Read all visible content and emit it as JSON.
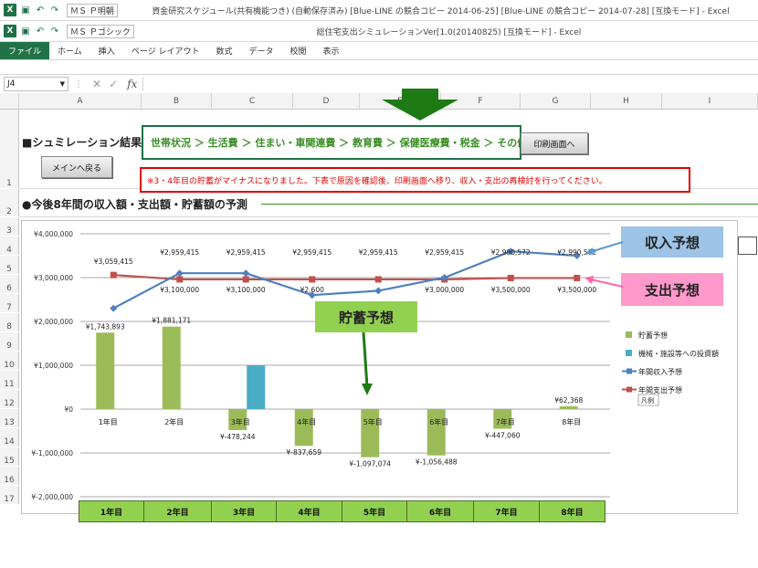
{
  "window1": {
    "title": "資金研究スケジュール(共有機能つき) (自動保存済み) [Blue-LINE の競合コピー 2014-06-25] [Blue-LINE の競合コピー 2014-07-28] [互換モード] - Excel",
    "font": "ＭＳ Ｐ明朝"
  },
  "window2": {
    "title": "総住宅支出シミュレーションVer[1.0(20140825)  [互換モード] - Excel",
    "font": "ＭＳ Ｐゴシック"
  },
  "ribbon": {
    "tabs": [
      "ファイル",
      "ホーム",
      "挿入",
      "ページ レイアウト",
      "数式",
      "データ",
      "校閲",
      "表示"
    ]
  },
  "formula_bar": {
    "name_box": "J4",
    "fx": "fx"
  },
  "columns": [
    "A",
    "B",
    "C",
    "D",
    "E",
    "F",
    "G",
    "H",
    "I"
  ],
  "rows": [
    "1",
    "2",
    "3",
    "4",
    "5",
    "6",
    "7",
    "8",
    "9",
    "10",
    "11",
    "12",
    "13",
    "14",
    "15",
    "16",
    "17"
  ],
  "sheet": {
    "heading": "■シュミレーション結果",
    "back_button": "メインへ戻る",
    "nav_breadcrumb": "世帯状況 ＞ 生活費 ＞ 住まい・車関連費 ＞ 教育費 ＞ 保健医療費・税金 ＞ その他",
    "print_button": "印刷画面へ",
    "warning": "※3・4年目の貯蓄がマイナスになりました。下表で原因を確認後、印刷画面へ移り、収入・支出の再検討を行ってください。",
    "section_title": "●今後8年間の収入額・支出額・貯蓄額の予測"
  },
  "callouts": {
    "income": "収入予想",
    "expense": "支出予想",
    "savings": "貯蓄予想"
  },
  "colors": {
    "savings": "#9bbb59",
    "investment": "#4bacc6",
    "income": "#4f81bd",
    "expense": "#c0504d",
    "callout_blue": "#9dc3e6",
    "callout_pink": "#ff99cc",
    "callout_green": "#92d050",
    "arrow": "#1e7a14"
  },
  "chart_data": {
    "type": "bar",
    "categories": [
      "1年目",
      "2年目",
      "3年目",
      "4年目",
      "5年目",
      "6年目",
      "7年目",
      "8年目"
    ],
    "ylim": [
      -2000000,
      4000000
    ],
    "y_ticks": [
      "¥4,000,000",
      "¥3,000,000",
      "¥2,000,000",
      "¥1,000,000",
      "¥0",
      "¥-1,000,000",
      "¥-2,000,000"
    ],
    "series": [
      {
        "name": "貯蓄予想",
        "type": "bar",
        "values": [
          1743893,
          1881171,
          -478244,
          -837659,
          -1097074,
          -1056488,
          -447060,
          62368
        ],
        "labels": [
          "¥1,743,893",
          "¥1,881,171",
          "¥-478,244",
          "¥-837,659",
          "¥-1,097,074",
          "¥-1,056,488",
          "¥-447,060",
          "¥62,368"
        ]
      },
      {
        "name": "機械・施設等への投資額",
        "type": "bar",
        "values": [
          0,
          0,
          1000000,
          0,
          0,
          0,
          0,
          0
        ]
      },
      {
        "name": "年間収入予想",
        "type": "line",
        "values": [
          2300000,
          3100000,
          3100000,
          2600000,
          2700000,
          3000000,
          3600000,
          3500000
        ],
        "labels": [
          "",
          "¥2,959,415",
          "¥2,959,415",
          "¥2,959,415",
          "¥2,959,415",
          "¥2,959,415",
          "¥2,990,572",
          "¥2,990,572"
        ]
      },
      {
        "name": "年間支出予想",
        "type": "line",
        "values": [
          3059415,
          2959415,
          2959415,
          2959415,
          2959415,
          2959415,
          2990572,
          2990572
        ],
        "labels": [
          "¥3,059,415",
          "¥3,100,000",
          "¥3,100,000",
          "¥2,600",
          "",
          "¥3,000,000",
          "¥3,500,000",
          "¥3,500,000"
        ]
      }
    ],
    "legend_position": "right",
    "legend_tooltip": "凡例",
    "grid": true
  }
}
